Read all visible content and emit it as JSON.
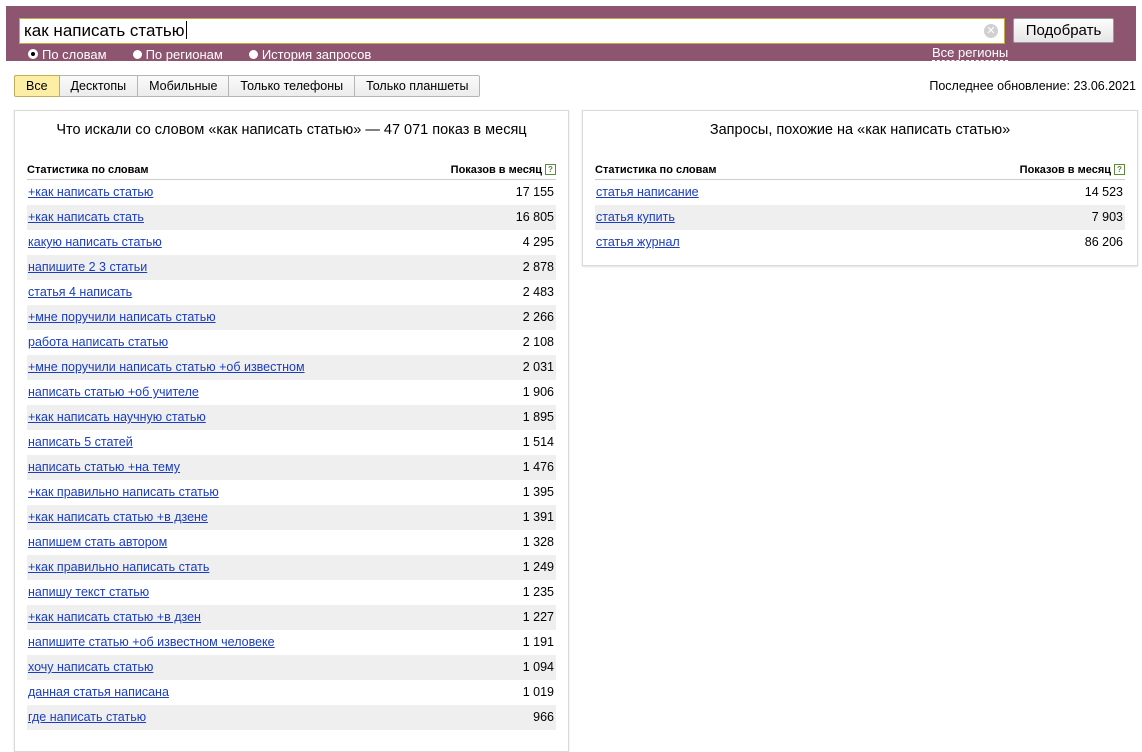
{
  "search": {
    "value": "как написать статью",
    "button_label": "Подобрать"
  },
  "modes": [
    {
      "label": "По словам",
      "checked": true
    },
    {
      "label": "По регионам",
      "checked": false
    },
    {
      "label": "История запросов",
      "checked": false
    }
  ],
  "regions_label": "Все регионы",
  "tabs": [
    "Все",
    "Десктопы",
    "Мобильные",
    "Только телефоны",
    "Только планшеты"
  ],
  "active_tab": "Все",
  "updated": "Последнее обновление: 23.06.2021",
  "left": {
    "title": "Что искали со словом «как написать статью» — 47 071 показ в месяц",
    "col1": "Статистика по словам",
    "col2": "Показов в месяц",
    "rows": [
      {
        "phrase": "+как написать статью",
        "count": "17 155"
      },
      {
        "phrase": "+как написать стать",
        "count": "16 805"
      },
      {
        "phrase": "какую написать статью",
        "count": "4 295"
      },
      {
        "phrase": "напишите 2 3 статьи",
        "count": "2 878"
      },
      {
        "phrase": "статья 4 написать",
        "count": "2 483"
      },
      {
        "phrase": "+мне поручили написать статью",
        "count": "2 266"
      },
      {
        "phrase": "работа написать статью",
        "count": "2 108"
      },
      {
        "phrase": "+мне поручили написать статью +об известном",
        "count": "2 031"
      },
      {
        "phrase": "написать статью +об учителе",
        "count": "1 906"
      },
      {
        "phrase": "+как написать научную статью",
        "count": "1 895"
      },
      {
        "phrase": "написать 5 статей",
        "count": "1 514"
      },
      {
        "phrase": "написать статью +на тему",
        "count": "1 476"
      },
      {
        "phrase": "+как правильно написать статью",
        "count": "1 395"
      },
      {
        "phrase": "+как написать статью +в дзене",
        "count": "1 391"
      },
      {
        "phrase": "напишем стать автором",
        "count": "1 328"
      },
      {
        "phrase": "+как правильно написать стать",
        "count": "1 249"
      },
      {
        "phrase": "напишу текст статью",
        "count": "1 235"
      },
      {
        "phrase": "+как написать статью +в дзен",
        "count": "1 227"
      },
      {
        "phrase": "напишите статью +об известном человеке",
        "count": "1 191"
      },
      {
        "phrase": "хочу написать статью",
        "count": "1 094"
      },
      {
        "phrase": "данная статья написана",
        "count": "1 019"
      },
      {
        "phrase": "где написать статью",
        "count": "966"
      }
    ]
  },
  "right": {
    "title": "Запросы, похожие на «как написать статью»",
    "col1": "Статистика по словам",
    "col2": "Показов в месяц",
    "rows": [
      {
        "phrase": "статья написание",
        "count": "14 523"
      },
      {
        "phrase": "статья купить",
        "count": "7 903"
      },
      {
        "phrase": "статья журнал",
        "count": "86 206"
      }
    ]
  },
  "colors": {
    "header_bg": "#8e5570",
    "link": "#1a3dc1",
    "active_tab": "#fdeea5"
  }
}
